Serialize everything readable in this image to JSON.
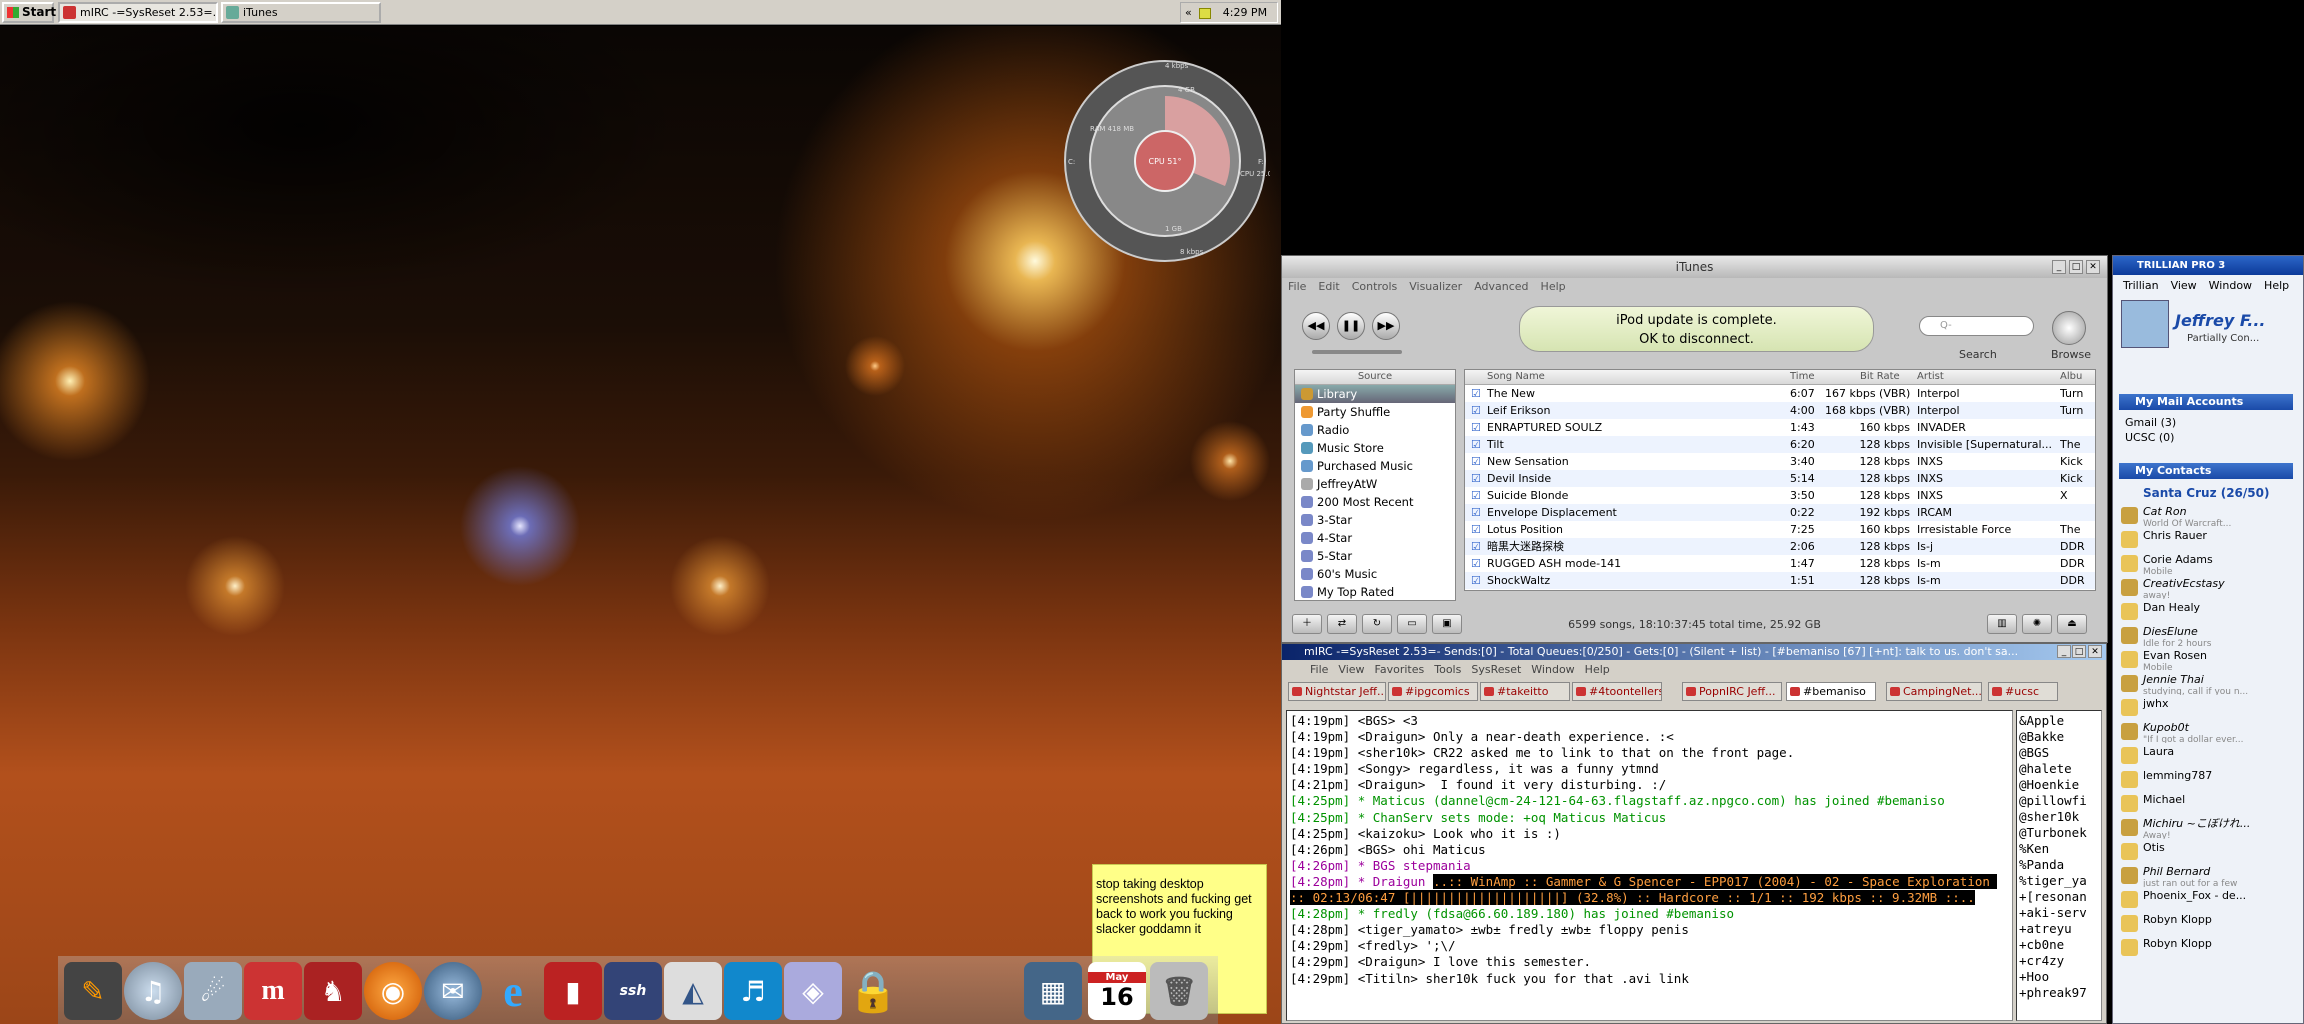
{
  "taskbar": {
    "start": "Start",
    "tasks": [
      {
        "label": "mIRC -=SysReset 2.53=..."
      },
      {
        "label": "iTunes"
      }
    ],
    "tray_chevron": "«",
    "time": "4:29 PM"
  },
  "gauge": {
    "ram": "RAM\n418 MB",
    "top": "4 kbps",
    "cpu": "CPU 51°",
    "cpu2": "CPU\n25.0°",
    "bottom": "8 kbps",
    "left": "C:",
    "right": "F:",
    "g1": "1 GB",
    "g2": "4 GB"
  },
  "sticky": {
    "text": "stop taking desktop screenshots and fucking get back to work you fucking slacker goddamn it"
  },
  "dock": {
    "items": [
      "pen-icon",
      "itunes-icon",
      "feather-icon",
      "mirc-icon",
      "fox-icon",
      "firefox-icon",
      "thunderbird-icon",
      "ie-icon",
      "book-icon",
      "ssh-icon",
      "adobe-icon",
      "music-icon",
      "box-icon",
      "lock-icon",
      "window-icon",
      "calendar-icon",
      "trash-icon"
    ],
    "cal_month": "May",
    "cal_day": "16",
    "ssh": "ssh"
  },
  "itunes": {
    "title": "iTunes",
    "menu": [
      "File",
      "Edit",
      "Controls",
      "Visualizer",
      "Advanced",
      "Help"
    ],
    "lcd_line1": "iPod update is complete.",
    "lcd_line2": "OK to disconnect.",
    "search_placeholder": "Q-",
    "search_label": "Search",
    "browse_label": "Browse",
    "source_header": "Source",
    "sources": [
      "Library",
      "Party Shuffle",
      "Radio",
      "Music Store",
      "Purchased Music",
      "JeffreyAtW",
      "200 Most Recent",
      "3-Star",
      "4-Star",
      "5-Star",
      "60's Music",
      "My Top Rated"
    ],
    "columns": [
      "Song Name",
      "Time",
      "Bit Rate",
      "Artist",
      "Albu"
    ],
    "songs": [
      [
        "The New",
        "6:07",
        "167 kbps (VBR)",
        "Interpol",
        "Turn"
      ],
      [
        "Leif Erikson",
        "4:00",
        "168 kbps (VBR)",
        "Interpol",
        "Turn"
      ],
      [
        "ENRAPTURED SOULZ",
        "1:43",
        "160 kbps",
        "INVADER",
        ""
      ],
      [
        "Tilt",
        "6:20",
        "128 kbps",
        "Invisible [Supernatural...",
        "The"
      ],
      [
        "New Sensation",
        "3:40",
        "128 kbps",
        "INXS",
        "Kick"
      ],
      [
        "Devil Inside",
        "5:14",
        "128 kbps",
        "INXS",
        "Kick"
      ],
      [
        "Suicide Blonde",
        "3:50",
        "128 kbps",
        "INXS",
        "X"
      ],
      [
        "Envelope Displacement",
        "0:22",
        "192 kbps",
        "IRCAM",
        ""
      ],
      [
        "Lotus Position",
        "7:25",
        "160 kbps",
        "Irresistable Force",
        "The"
      ],
      [
        "暗黒大迷路探検",
        "2:06",
        "128 kbps",
        "Is-j",
        "DDR"
      ],
      [
        "RUGGED ASH mode-141",
        "1:47",
        "128 kbps",
        "Is-m",
        "DDR"
      ],
      [
        "ShockWaltz",
        "1:51",
        "128 kbps",
        "Is-m",
        "DDR"
      ]
    ],
    "status": "6599 songs, 18:10:37:45 total time, 25.92 GB"
  },
  "mirc": {
    "title": "mIRC -=SysReset 2.53=- Sends:[0] - Total Queues:[0/250] - Gets:[0] - (Silent + list) - [#bemaniso [67] [+nt]: talk to us. don't sa...",
    "menu": [
      "File",
      "View",
      "Favorites",
      "Tools",
      "SysReset",
      "Window",
      "Help"
    ],
    "tabs": [
      "Nightstar Jeff...",
      "#ipgcomics",
      "#takeitto",
      "#4toontellers",
      "PopnIRC Jeff...",
      "#bemaniso",
      "CampingNet...",
      "#ucsc"
    ],
    "lines": [
      {
        "t": "[4:19pm] <BGS> <3",
        "c": "#000"
      },
      {
        "t": "[4:19pm] <Draigun> Only a near-death experience. :<",
        "c": "#000"
      },
      {
        "t": "[4:19pm] <sher10k> CR22 asked me to link to that on the front page.",
        "c": "#000"
      },
      {
        "t": "[4:19pm] <Songy> regardless, it was a funny ytmnd",
        "c": "#000"
      },
      {
        "t": "[4:21pm] <Draigun>  I found it very disturbing. :/",
        "c": "#000"
      },
      {
        "t": "[4:25pm] * Maticus (dannel@cm-24-121-64-63.flagstaff.az.npgco.com) has joined #bemaniso",
        "c": "#009300"
      },
      {
        "t": "[4:25pm] * ChanServ sets mode: +oq Maticus Maticus",
        "c": "#009300"
      },
      {
        "t": "[4:25pm] <kaizoku> Look who it is :)",
        "c": "#000"
      },
      {
        "t": "[4:26pm] <BGS> ohi Maticus",
        "c": "#000"
      },
      {
        "t": "[4:26pm] * BGS stepmania",
        "c": "#9c009c"
      },
      {
        "t": "[4:28pm] * Draigun",
        "c": "#9c009c",
        "hl": "..:: WinAmp :: Gammer & G Spencer - EPP017 (2004) - 02 - Space Exploration :: 02:13/06:47 [||||||||||||||||||||] (32.8%) :: Hardcore :: 1/1 :: 192 kbps :: 9.32MB ::.."
      },
      {
        "t": "[4:28pm] * fredly (fdsa@66.60.189.180) has joined #bemaniso",
        "c": "#009300"
      },
      {
        "t": "[4:28pm] <tiger_yamato> ±wb± fredly ±wb± floppy penis",
        "c": "#000"
      },
      {
        "t": "[4:29pm] <fredly> ';\\/",
        "c": "#000"
      },
      {
        "t": "[4:29pm] <Draigun> I love this semester.",
        "c": "#000"
      },
      {
        "t": "[4:29pm] <Titiln> sher10k fuck you for that .avi link",
        "c": "#000"
      }
    ],
    "nicks": [
      "&Apple",
      "@Bakke",
      "@BGS",
      "@halete",
      "@Hoenkie",
      "@pillowfi",
      "@sher10k",
      "@Turbonek",
      "%Ken",
      "%Panda",
      "%tiger_ya",
      "+[resonan",
      "+aki-serv",
      "+atreyu",
      "+cb0ne",
      "+cr4zy",
      "+Hoo",
      "+phreak97"
    ]
  },
  "trillian": {
    "title": "TRILLIAN PRO 3",
    "menu": [
      "Trillian",
      "View",
      "Window",
      "Help"
    ],
    "user": "Jeffrey F...",
    "status": "Partially Con...",
    "mail_header": "My Mail Accounts",
    "mail": [
      "Gmail (3)",
      "UCSC (0)"
    ],
    "contacts_header": "My Contacts",
    "group": "Santa Cruz (26/50)",
    "contacts": [
      {
        "n": "Cat Ron",
        "s": "World Of Warcraft...",
        "away": true
      },
      {
        "n": "Chris Rauer",
        "s": ""
      },
      {
        "n": "Corie Adams",
        "s": "Mobile"
      },
      {
        "n": "CreativEcstasy",
        "s": "away!",
        "away": true
      },
      {
        "n": "Dan Healy",
        "s": ""
      },
      {
        "n": "DiesElune",
        "s": "Idle for 2 hours",
        "away": true
      },
      {
        "n": "Evan Rosen",
        "s": "Mobile"
      },
      {
        "n": "Jennie Thai",
        "s": "studying, call if you n...",
        "away": true
      },
      {
        "n": "jwhx",
        "s": ""
      },
      {
        "n": "Kupob0t",
        "s": "\"If I got a dollar ever...",
        "away": true
      },
      {
        "n": "Laura",
        "s": ""
      },
      {
        "n": "lemming787",
        "s": ""
      },
      {
        "n": "Michael",
        "s": ""
      },
      {
        "n": "Michiru ~こぼけれ...",
        "s": "Away!",
        "away": true
      },
      {
        "n": "Otis",
        "s": ""
      },
      {
        "n": "Phil Bernard",
        "s": "just ran out for a few",
        "away": true
      },
      {
        "n": "Phoenix_Fox - de...",
        "s": ""
      },
      {
        "n": "Robyn Klopp",
        "s": ""
      },
      {
        "n": "Robyn Klopp",
        "s": ""
      }
    ],
    "proto": "AIM"
  }
}
